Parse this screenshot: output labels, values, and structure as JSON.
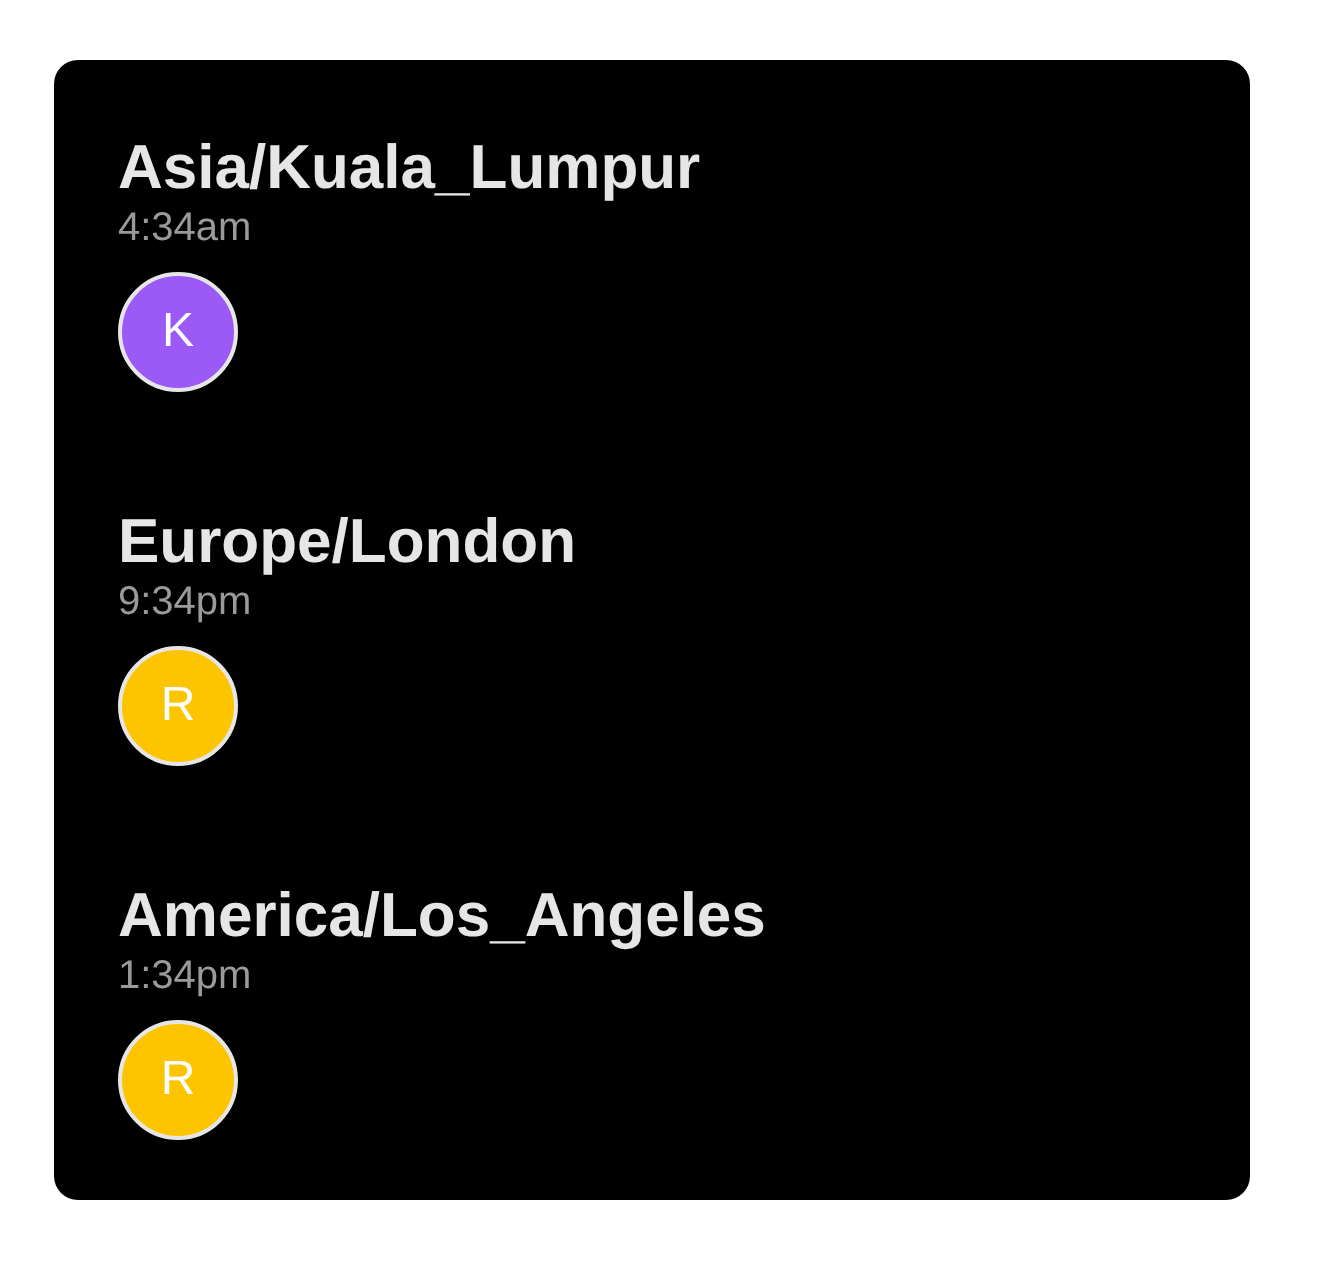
{
  "zones": [
    {
      "timezone": "Asia/Kuala_Lumpur",
      "time": "4:34am",
      "people": [
        {
          "initial": "K",
          "color": "#9b59f6"
        }
      ]
    },
    {
      "timezone": "Europe/London",
      "time": "9:34pm",
      "people": [
        {
          "initial": "R",
          "color": "#fdc500"
        }
      ]
    },
    {
      "timezone": "America/Los_Angeles",
      "time": "1:34pm",
      "people": [
        {
          "initial": "R",
          "color": "#fdc500"
        }
      ]
    }
  ]
}
